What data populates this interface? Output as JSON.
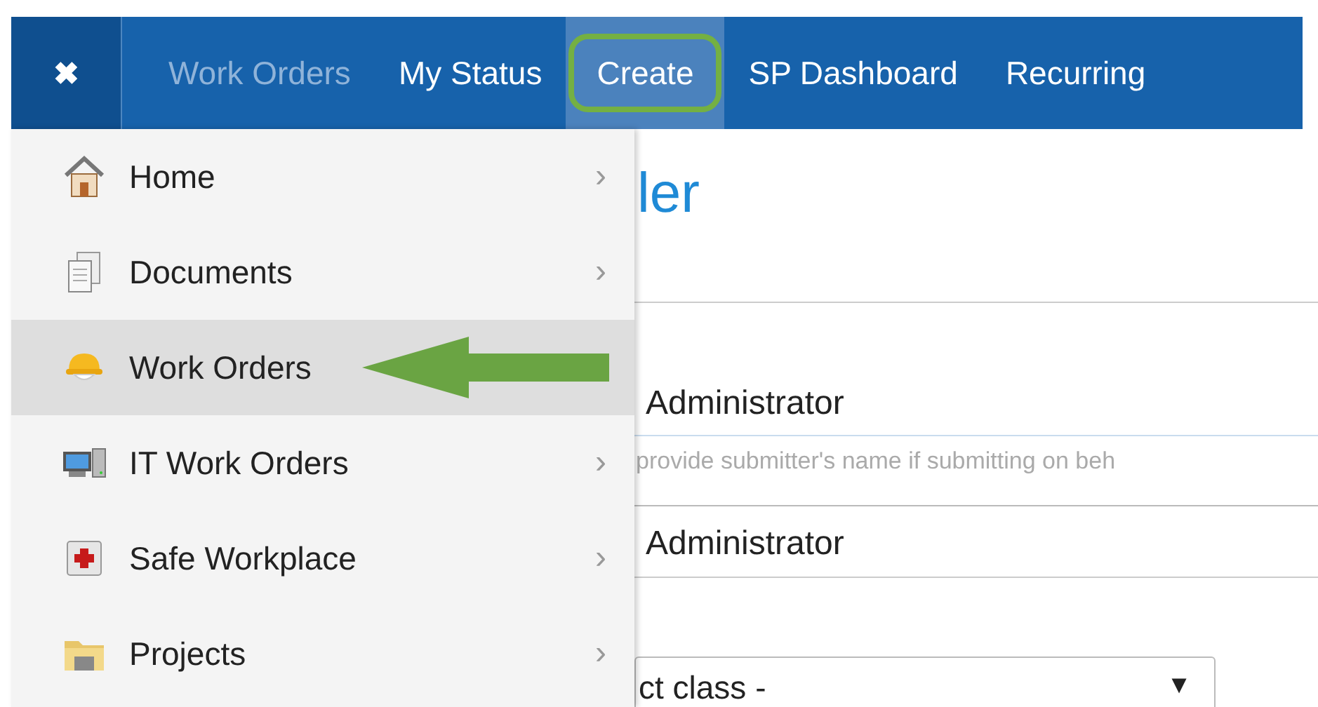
{
  "navbar": {
    "close_icon": "✖",
    "items": [
      {
        "label": "Work Orders",
        "selected": false,
        "dimmed": true
      },
      {
        "label": "My Status",
        "selected": false,
        "dimmed": false
      },
      {
        "label": "Create",
        "selected": true,
        "dimmed": false
      },
      {
        "label": "SP Dashboard",
        "selected": false,
        "dimmed": false
      },
      {
        "label": "Recurring",
        "selected": false,
        "dimmed": false
      }
    ]
  },
  "menu": {
    "items": [
      {
        "label": "Home",
        "selected": false,
        "has_submenu": true
      },
      {
        "label": "Documents",
        "selected": false,
        "has_submenu": true
      },
      {
        "label": "Work Orders",
        "selected": true,
        "has_submenu": false
      },
      {
        "label": "IT Work Orders",
        "selected": false,
        "has_submenu": true
      },
      {
        "label": "Safe Workplace",
        "selected": false,
        "has_submenu": true
      },
      {
        "label": "Projects",
        "selected": false,
        "has_submenu": true
      }
    ],
    "submenu_mark": "›"
  },
  "page": {
    "title": "ler",
    "requester_value": "Administrator",
    "hint": "provide submitter's name if submitting on beh",
    "submitter_value": "Administrator",
    "class_select": {
      "value": "ct class -",
      "caret": "▼"
    }
  }
}
